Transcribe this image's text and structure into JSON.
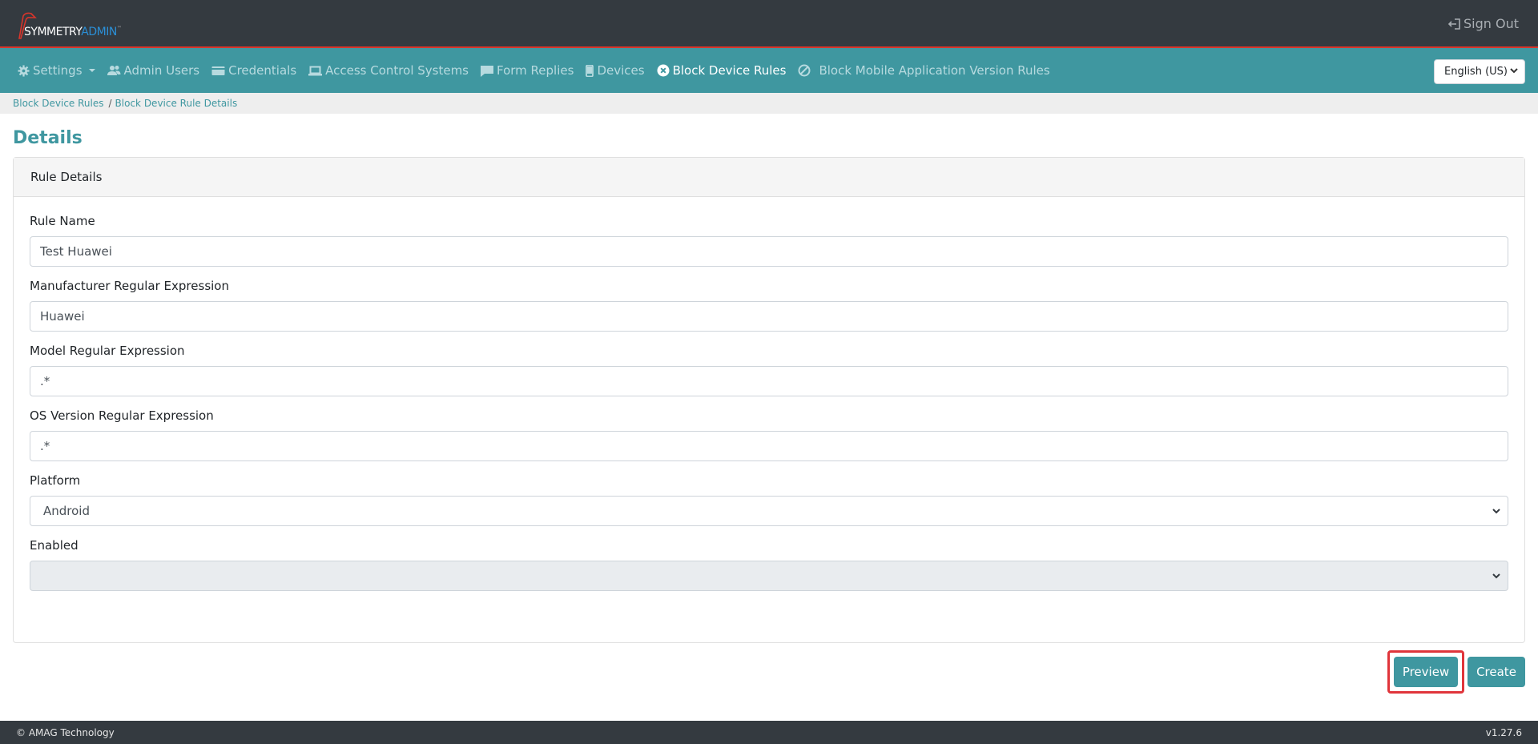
{
  "header": {
    "logo": {
      "brand_primary": "SYMMETRY",
      "brand_secondary": "ADMIN",
      "trademark": "™"
    },
    "sign_out_label": "Sign Out"
  },
  "nav": {
    "items": [
      {
        "label": "Settings",
        "icon": "gear-icon",
        "has_dropdown": true,
        "active": false
      },
      {
        "label": "Admin Users",
        "icon": "users-icon",
        "active": false
      },
      {
        "label": "Credentials",
        "icon": "card-icon",
        "active": false
      },
      {
        "label": "Access Control Systems",
        "icon": "laptop-icon",
        "active": false
      },
      {
        "label": "Form Replies",
        "icon": "comment-icon",
        "active": false
      },
      {
        "label": "Devices",
        "icon": "mobile-icon",
        "active": false
      },
      {
        "label": "Block Device Rules",
        "icon": "times-circle-icon",
        "active": true
      },
      {
        "label": "Block Mobile Application Version Rules",
        "icon": "ban-icon",
        "active": false
      }
    ],
    "language": {
      "selected": "English (US)"
    }
  },
  "breadcrumb": {
    "items": [
      {
        "label": "Block Device Rules"
      },
      {
        "label": "Block Device Rule Details"
      }
    ],
    "separator": "/"
  },
  "page": {
    "title": "Details",
    "card_title": "Rule Details",
    "fields": {
      "rule_name": {
        "label": "Rule Name",
        "value": "Test Huawei"
      },
      "manufacturer": {
        "label": "Manufacturer Regular Expression",
        "value": "Huawei"
      },
      "model": {
        "label": "Model Regular Expression",
        "value": ".*"
      },
      "os_version": {
        "label": "OS Version Regular Expression",
        "value": ".*"
      },
      "platform": {
        "label": "Platform",
        "selected": "Android"
      },
      "enabled": {
        "label": "Enabled",
        "selected": "",
        "disabled": true
      }
    },
    "buttons": {
      "preview": "Preview",
      "create": "Create"
    }
  },
  "footer": {
    "copyright": "© AMAG Technology",
    "version": "v1.27.6"
  },
  "colors": {
    "topbar": "#343a40",
    "accent": "#3f97a0",
    "highlight": "#e0353b",
    "brand_red": "#d9352b",
    "brand_blue": "#2b8fd6"
  }
}
